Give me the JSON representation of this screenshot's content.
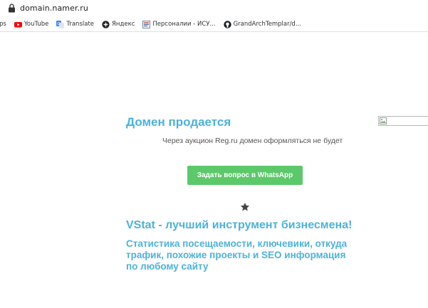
{
  "browser": {
    "url": "domain.namer.ru",
    "bookmarks": [
      {
        "label": "ps",
        "icon": "apps-icon"
      },
      {
        "label": "YouTube",
        "icon": "youtube-icon"
      },
      {
        "label": "Translate",
        "icon": "translate-icon"
      },
      {
        "label": "Яндекс",
        "icon": "yandex-icon"
      },
      {
        "label": "Персоналии - ИСУ...",
        "icon": "page-icon"
      },
      {
        "label": "GrandArchTemplar/d...",
        "icon": "github-icon"
      }
    ]
  },
  "page": {
    "title": "Домен продается",
    "subtitle": "Через аукцион Reg.ru домен оформляться не будет",
    "whatsapp_button": "Задать вопрос в WhatsApp",
    "headline": "VStat - лучший инструмент бизнесмена!",
    "description": "Статистика посещаемости, ключевики, откуда трафик, похожие проекты и SEO информация по любому сайту"
  },
  "colors": {
    "accent": "#4cb2d9",
    "button": "#5bc96a",
    "star": "#444444"
  }
}
